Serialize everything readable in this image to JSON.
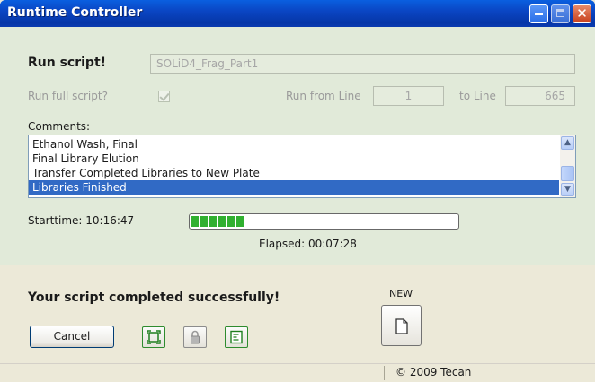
{
  "window": {
    "title": "Runtime Controller"
  },
  "script": {
    "label": "Run script!",
    "name": "SOLiD4_Frag_Part1"
  },
  "run_options": {
    "full_script_label": "Run full script?",
    "full_script_checked": true,
    "from_line_label": "Run from Line",
    "from_line_value": "1",
    "to_line_label": "to Line",
    "to_line_value": "665"
  },
  "comments": {
    "label": "Comments:",
    "items": [
      "Ethanol Wash, Final",
      "Final Library Elution",
      "Transfer Completed Libraries to New Plate",
      "Libraries Finished"
    ],
    "selected_index": 3
  },
  "timing": {
    "starttime_label": "Starttime: 10:16:47",
    "elapsed_label": "Elapsed: 00:07:28",
    "progress_fraction": 0.2
  },
  "status": {
    "message": "Your script completed successfully!",
    "new_label": "NEW",
    "copyright": "© 2009 Tecan"
  },
  "buttons": {
    "cancel_label": "Cancel"
  },
  "icons": {
    "minimize": "minimize-icon",
    "maximize": "maximize-icon",
    "close": "close-icon",
    "fit": "fit-screen-icon",
    "lock": "padlock-icon",
    "log": "log-text-icon",
    "new": "new-document-icon"
  },
  "colors": {
    "titlebar": "#0a46c4",
    "selection": "#316ac5",
    "progress": "#30b030"
  }
}
